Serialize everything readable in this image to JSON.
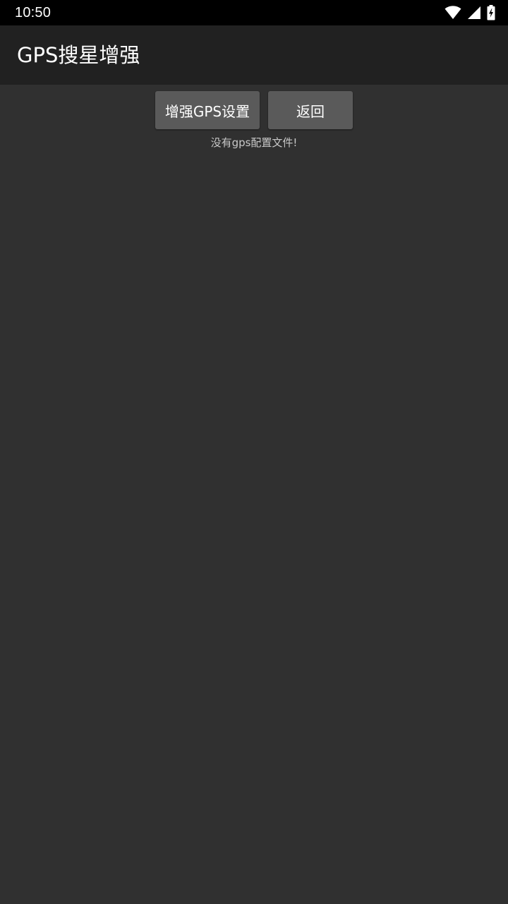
{
  "status_bar": {
    "time": "10:50",
    "icons": [
      "wifi-icon",
      "cell-signal-icon",
      "battery-charging-icon"
    ]
  },
  "app_bar": {
    "title": "GPS搜星增强"
  },
  "actions": {
    "enhance_label": "增强GPS设置",
    "back_label": "返回"
  },
  "message": {
    "text": "没有gps配置文件!"
  },
  "colors": {
    "status_bar_bg": "#000000",
    "app_bar_bg": "#212121",
    "content_bg": "#303030",
    "button_bg": "#5a5a5a",
    "text_primary": "#ffffff",
    "text_secondary": "#c8c8c8"
  }
}
